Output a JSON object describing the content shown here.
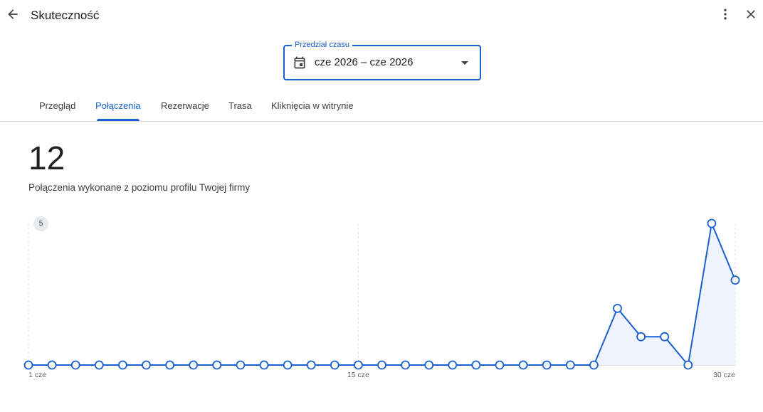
{
  "header": {
    "title": "Skuteczność",
    "back_icon": "arrow-back-icon",
    "more_icon": "more-vert-icon",
    "close_icon": "close-icon"
  },
  "range": {
    "label": "Przedział czasu",
    "value": "cze 2026 – cze 2026",
    "calendar_icon": "calendar-icon",
    "dropdown_icon": "arrow-drop-down-icon"
  },
  "tabs": [
    {
      "label": "Przegląd",
      "active": false
    },
    {
      "label": "Połączenia",
      "active": true
    },
    {
      "label": "Rezerwacje",
      "active": false
    },
    {
      "label": "Trasa",
      "active": false
    },
    {
      "label": "Kliknięcia w witrynie",
      "active": false
    }
  ],
  "metric": {
    "value": "12",
    "caption": "Połączenia wykonane z poziomu profilu Twojej firmy"
  },
  "colors": {
    "accent": "#1a5fd0",
    "area_fill": "#eef3fd"
  },
  "chart_data": {
    "type": "area",
    "x": [
      1,
      2,
      3,
      4,
      5,
      6,
      7,
      8,
      9,
      10,
      11,
      12,
      13,
      14,
      15,
      16,
      17,
      18,
      19,
      20,
      21,
      22,
      23,
      24,
      25,
      26,
      27,
      28,
      29,
      30
    ],
    "series": [
      {
        "values": [
          0,
          0,
          0,
          0,
          0,
          0,
          0,
          0,
          0,
          0,
          0,
          0,
          0,
          0,
          0,
          0,
          0,
          0,
          0,
          0,
          0,
          0,
          0,
          0,
          0,
          2,
          1,
          1,
          0,
          5,
          3
        ]
      }
    ],
    "ylim": [
      0,
      5
    ],
    "x_tick_labels": [
      {
        "x": 1,
        "label": "1 cze"
      },
      {
        "x": 15,
        "label": "15 cze"
      },
      {
        "x": 30,
        "label": "30 cze"
      }
    ],
    "y_max_label": "5",
    "grid": "vertical-dashed"
  }
}
